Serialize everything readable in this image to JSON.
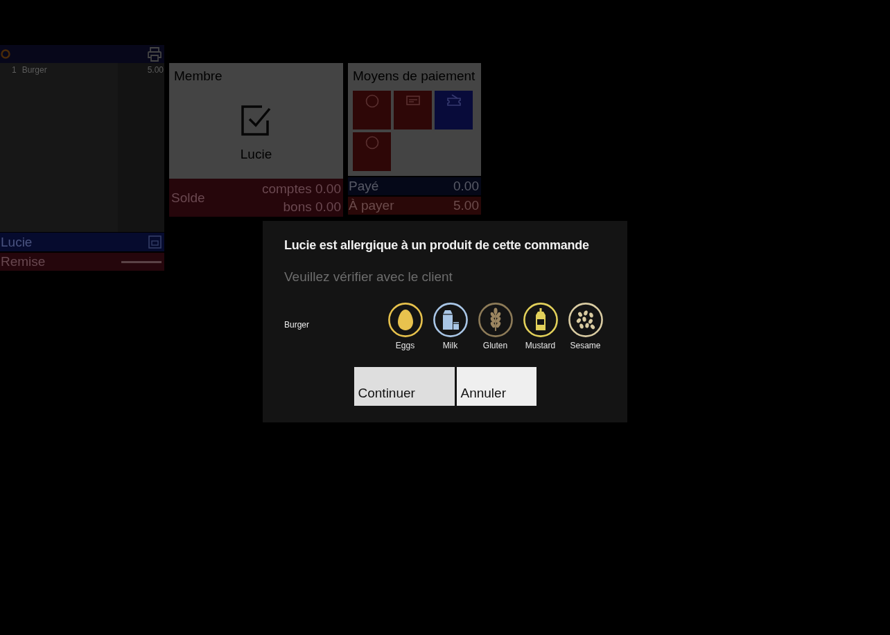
{
  "order_panel": {
    "items": [
      {
        "quantity": "1",
        "name": "Burger",
        "price": "5.00"
      }
    ],
    "customer": "Lucie",
    "discount_label": "Remise"
  },
  "member_panel": {
    "title": "Membre",
    "checked": true,
    "name": "Lucie",
    "balance_label": "Solde",
    "accounts": "comptes 0.00",
    "vouchers": "bons 0.00"
  },
  "payment_panel": {
    "title": "Moyens de paiement",
    "methods": [
      {
        "kind": "coin",
        "color": "#2e0707"
      },
      {
        "kind": "card",
        "color": "#2e0707"
      },
      {
        "kind": "voucher",
        "color": "#080b3a"
      },
      {
        "kind": "coin",
        "color": "#2e0707"
      }
    ],
    "paid_label": "Payé",
    "paid": "0.00",
    "due_label": "À payer",
    "due": "5.00"
  },
  "dialog": {
    "title": "Lucie est allergique à un produit de cette commande",
    "subtitle": "Veuillez vérifier avec le client",
    "rows": [
      {
        "product": "Burger",
        "allergens": [
          {
            "kind": "eggs",
            "label": "Eggs"
          },
          {
            "kind": "milk",
            "label": "Milk"
          },
          {
            "kind": "gluten",
            "label": "Gluten"
          },
          {
            "kind": "mustard",
            "label": "Mustard"
          },
          {
            "kind": "sesame",
            "label": "Sesame"
          }
        ]
      }
    ],
    "buttons": [
      {
        "kind": "primary",
        "label": "Continuer"
      },
      {
        "kind": "secondary",
        "label": "Annuler"
      }
    ]
  }
}
